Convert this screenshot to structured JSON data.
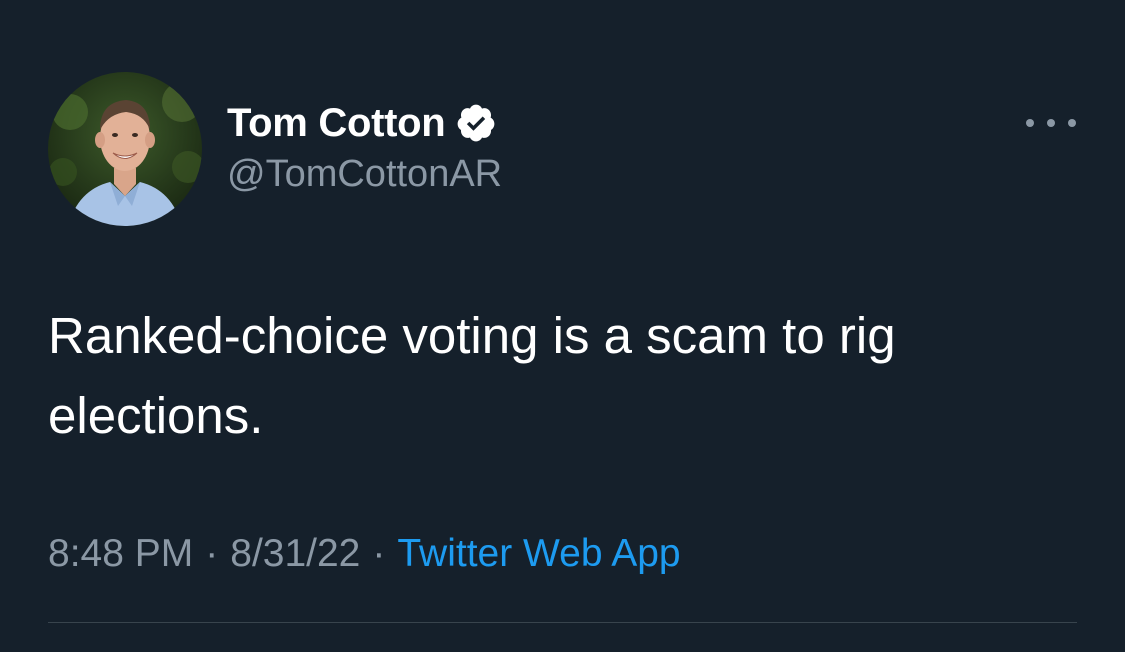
{
  "author": {
    "display_name": "Tom Cotton",
    "handle": "@TomCottonAR",
    "verified": true,
    "avatar": "profile-photo"
  },
  "tweet": {
    "text": "Ranked-choice voting is a scam to rig elections."
  },
  "meta": {
    "time": "8:48 PM",
    "separator": "·",
    "date": "8/31/22",
    "source": "Twitter Web App"
  },
  "icons": {
    "verified": "verified-badge-icon",
    "more": "more-options-icon"
  },
  "colors": {
    "background": "#15202B",
    "text_primary": "#FFFFFF",
    "text_secondary": "#8B98A5",
    "link": "#1D9BF0",
    "divider": "#38444D"
  }
}
